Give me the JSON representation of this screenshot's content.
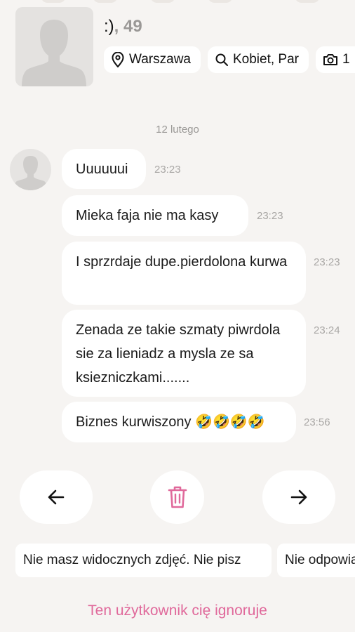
{
  "profile": {
    "name": ":)",
    "age": ", 49",
    "chips": [
      {
        "icon": "location-pin-icon",
        "label": "Warszawa"
      },
      {
        "icon": "search-icon",
        "label": "Kobiet, Par"
      },
      {
        "icon": "camera-icon",
        "label": "1"
      }
    ]
  },
  "chat": {
    "date": "12 lutego",
    "messages": [
      {
        "text": "Uuuuuui",
        "time": "23:23"
      },
      {
        "text": "Mieka faja nie ma kasy",
        "time": "23:23"
      },
      {
        "text": "I sprzrdaje dupe.pierdolona kurwa",
        "time": "23:23"
      },
      {
        "text": "Zenada ze takie szmaty piwrdola sie za lieniadz a mysla ze sa ksiezniczkami.......",
        "time": "23:24"
      },
      {
        "text": "Biznes kurwiszony 🤣🤣🤣🤣",
        "time": "23:56"
      }
    ]
  },
  "actions": {
    "prev": "arrow-left-icon",
    "delete": "trash-icon",
    "next": "arrow-right-icon",
    "delete_color": "#e0699b"
  },
  "templates": [
    "Nie masz widocznych zdjęć. Nie pisz",
    "Nie odpowiadam"
  ],
  "footer": {
    "ignore_note": "Ten użytkownik cię ignoruje"
  }
}
